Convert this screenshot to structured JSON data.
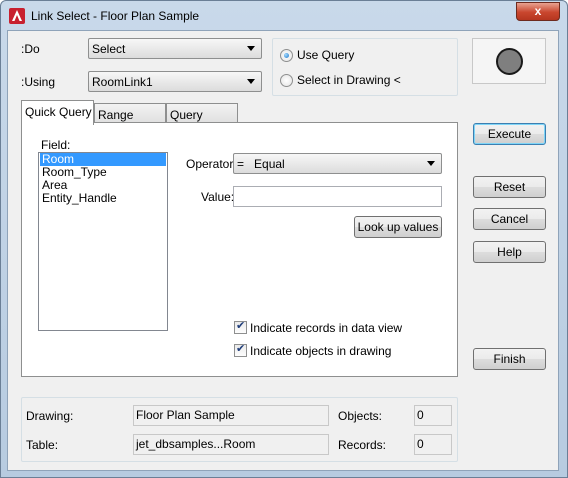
{
  "window": {
    "title": "Link Select - Floor Plan Sample",
    "close_label": "x"
  },
  "top": {
    "do_label": ":Do",
    "do_value": "Select",
    "using_label": ":Using",
    "using_value": "RoomLink1",
    "use_query_label": "Use Query",
    "select_in_drawing_label": "Select in Drawing <"
  },
  "tabs": [
    {
      "label": "Quick Query",
      "active": true
    },
    {
      "label": "Range Query",
      "active": false
    },
    {
      "label": "Query Builder",
      "active": false
    }
  ],
  "quick_query": {
    "field_label": "Field:",
    "fields": [
      "Room",
      "Room_Type",
      "Area",
      "Entity_Handle"
    ],
    "selected_field": "Room",
    "operator_label": "Operator:",
    "operator_value": "=   Equal",
    "value_label": "Value:",
    "value": "",
    "lookup_label": "Look up values",
    "indicate_records_label": "Indicate records in data view",
    "indicate_objects_label": "Indicate objects in drawing"
  },
  "buttons": {
    "execute": "Execute",
    "reset": "Reset",
    "cancel": "Cancel",
    "help": "Help",
    "finish": "Finish"
  },
  "status": {
    "drawing_label": "Drawing:",
    "drawing_value": "Floor Plan Sample",
    "table_label": "Table:",
    "table_value": "jet_dbsamples...Room",
    "objects_label": "Objects:",
    "objects_value": "0",
    "records_label": "Records:",
    "records_value": "0"
  }
}
